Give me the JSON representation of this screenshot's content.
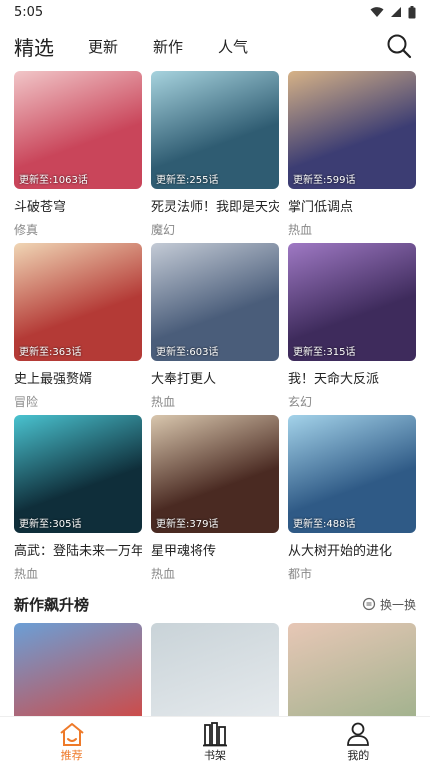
{
  "status": {
    "time": "5:05"
  },
  "nav": {
    "tabs": [
      "精选",
      "更新",
      "新作",
      "人气"
    ]
  },
  "comics": [
    {
      "title": "斗破苍穹",
      "genre": "修真",
      "update": "更新至:1063话",
      "colors": [
        "#c9455a",
        "#f1c6c8"
      ]
    },
    {
      "title": "死灵法师！我即是天灾",
      "genre": "魔幻",
      "update": "更新至:255话",
      "colors": [
        "#2f5c72",
        "#a7d3de"
      ]
    },
    {
      "title": "掌门低调点",
      "genre": "热血",
      "update": "更新至:599话",
      "colors": [
        "#3c3d73",
        "#d6b287"
      ]
    },
    {
      "title": "史上最强赘婿",
      "genre": "冒险",
      "update": "更新至:363话",
      "colors": [
        "#b43a36",
        "#f0d6b5"
      ]
    },
    {
      "title": "大奉打更人",
      "genre": "热血",
      "update": "更新至:603话",
      "colors": [
        "#4a5d7a",
        "#c4cbd6"
      ]
    },
    {
      "title": "我！天命大反派",
      "genre": "玄幻",
      "update": "更新至:315话",
      "colors": [
        "#3e2b5c",
        "#9f79c4"
      ]
    },
    {
      "title": "高武：登陆未来一万年",
      "genre": "热血",
      "update": "更新至:305话",
      "colors": [
        "#0f2e3a",
        "#4ac3d0"
      ]
    },
    {
      "title": "星甲魂将传",
      "genre": "热血",
      "update": "更新至:379话",
      "colors": [
        "#4a2a22",
        "#d9c7ae"
      ]
    },
    {
      "title": "从大树开始的进化",
      "genre": "都市",
      "update": "更新至:488话",
      "colors": [
        "#2f5a86",
        "#a4d3ea"
      ]
    }
  ],
  "section": {
    "title": "新作飙升榜",
    "swap_label": "换一换"
  },
  "new_comics": [
    {
      "colors": [
        "#d7423a",
        "#6b9fd6"
      ]
    },
    {
      "colors": [
        "#e8ecef",
        "#c9d3d8"
      ]
    },
    {
      "colors": [
        "#9bb08a",
        "#e7c7b6"
      ]
    }
  ],
  "bottom_nav": [
    {
      "label": "推荐",
      "icon": "home-icon",
      "active": true
    },
    {
      "label": "书架",
      "icon": "bookshelf-icon",
      "active": false
    },
    {
      "label": "我的",
      "icon": "user-icon",
      "active": false
    }
  ]
}
